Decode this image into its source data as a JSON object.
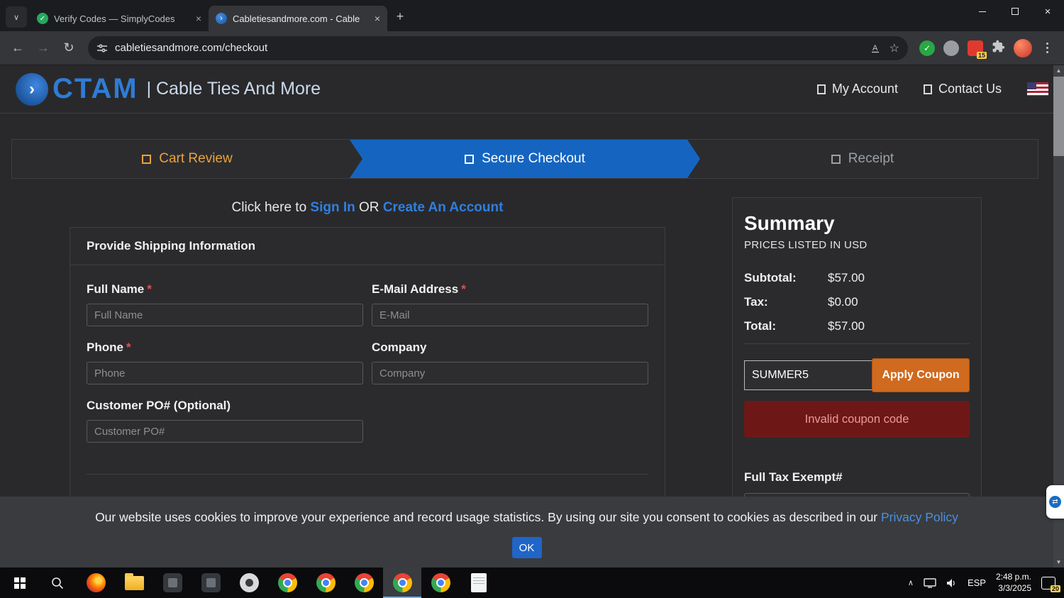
{
  "browser": {
    "tabs": [
      {
        "title": "Verify Codes — SimplyCodes"
      },
      {
        "title": "Cabletiesandmore.com - Cable"
      }
    ],
    "url": "cabletiesandmore.com/checkout",
    "extension_badge": "15"
  },
  "icons": {
    "chevron_down": "∨",
    "chevron_up": "∧",
    "close": "×",
    "new_tab": "+",
    "back": "←",
    "forward": "→",
    "reload": "↻",
    "bookmark_star": "☆",
    "check": "✓",
    "scroll_up": "▲",
    "scroll_down": "▼",
    "logo_chevron": "›",
    "tv_arrows": "⇄"
  },
  "site_header": {
    "logo_text": "CTAM",
    "tagline": "| Cable Ties And More",
    "my_account": "My Account",
    "contact_us": "Contact Us"
  },
  "steps": [
    {
      "label": "Cart Review"
    },
    {
      "label": "Secure Checkout"
    },
    {
      "label": "Receipt"
    }
  ],
  "signin": {
    "prefix": "Click here to ",
    "sign_in": "Sign In",
    "middle": " OR ",
    "create_account": "Create An Account"
  },
  "shipping_form": {
    "title": "Provide Shipping Information",
    "required_mark": "*",
    "fields": {
      "full_name": {
        "label": "Full Name",
        "placeholder": "Full Name"
      },
      "email": {
        "label": "E-Mail Address",
        "placeholder": "E-Mail"
      },
      "phone": {
        "label": "Phone",
        "placeholder": "Phone"
      },
      "company": {
        "label": "Company",
        "placeholder": "Company"
      },
      "customer_po": {
        "label": "Customer PO# (Optional)",
        "placeholder": "Customer PO#"
      }
    }
  },
  "summary": {
    "title": "Summary",
    "subtitle": "PRICES LISTED IN USD",
    "rows": [
      {
        "label": "Subtotal:",
        "value": "$57.00"
      },
      {
        "label": "Tax:",
        "value": "$0.00"
      },
      {
        "label": "Total:",
        "value": "$57.00"
      }
    ],
    "coupon_value": "SUMMER5",
    "apply_button": "Apply Coupon",
    "error_message": "Invalid coupon code",
    "tax_exempt_label": "Full Tax Exempt#"
  },
  "cookie_banner": {
    "message": "Our website uses cookies to improve your experience and record usage statistics. By using our site you consent to cookies as described in our ",
    "link": "Privacy Policy",
    "ok": "OK"
  },
  "taskbar": {
    "language": "ESP",
    "time": "2:48 p.m.",
    "date": "3/3/2025",
    "notification_badge": "20"
  },
  "colors": {
    "accent_blue": "#1565c0",
    "step_text_orange": "#e8a33d",
    "apply_button_orange": "#cf6a1f",
    "error_background": "#6e1717",
    "error_text": "#e89b9b",
    "link_blue": "#4a90e2"
  }
}
